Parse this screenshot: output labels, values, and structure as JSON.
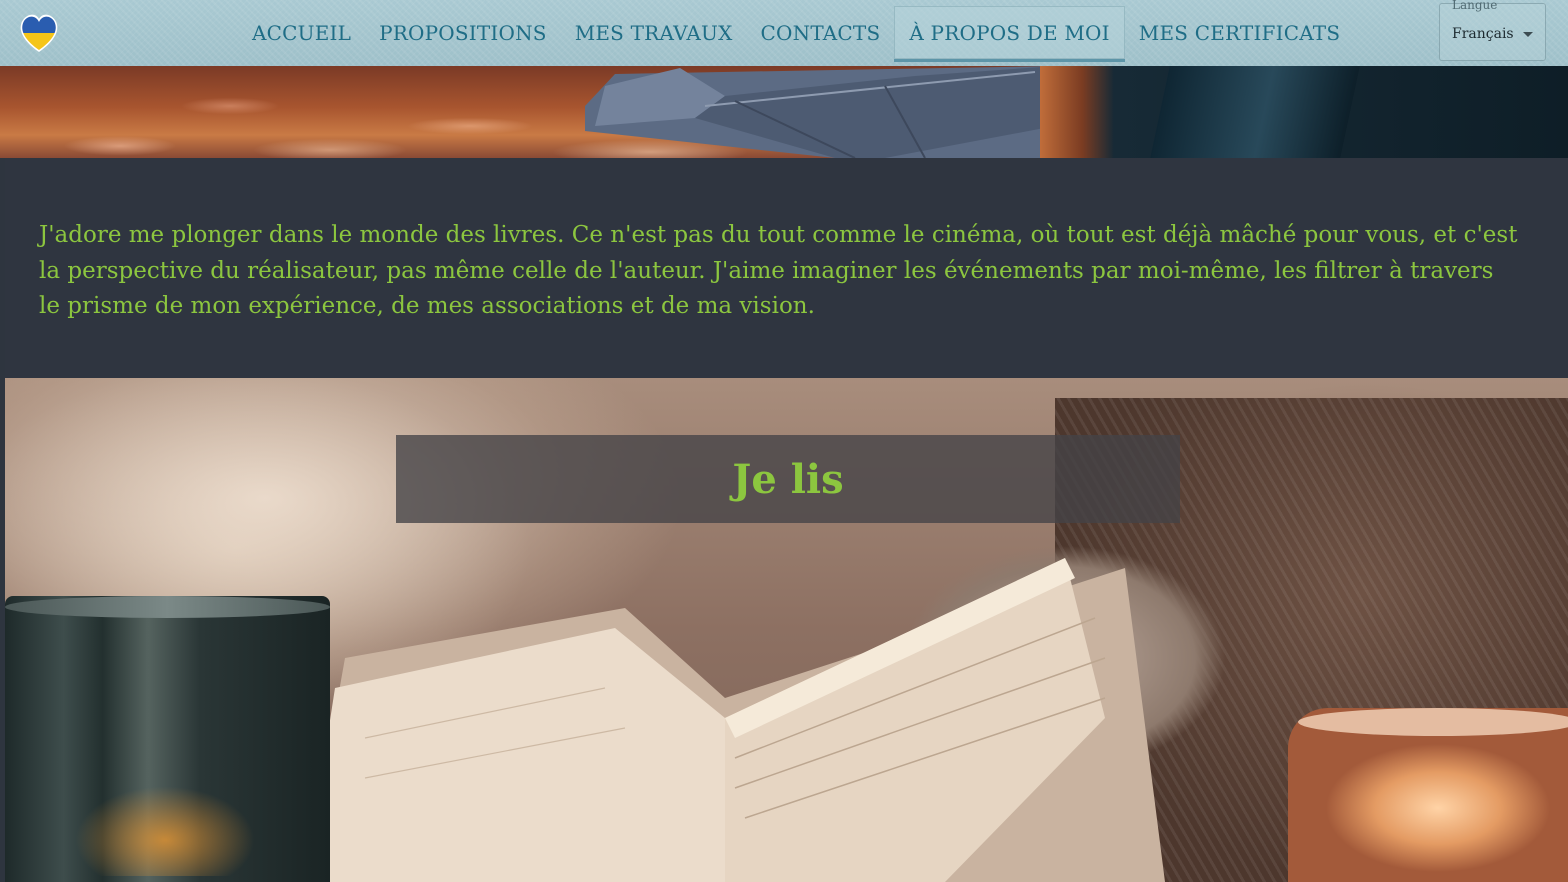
{
  "header": {
    "logo_icon": "heart-flag-icon",
    "nav": [
      {
        "label": "ACCUEIL",
        "active": false
      },
      {
        "label": "PROPOSITIONS",
        "active": false
      },
      {
        "label": "MES TRAVAUX",
        "active": false
      },
      {
        "label": "CONTACTS",
        "active": false
      },
      {
        "label": "À PROPOS DE MOI",
        "active": true
      },
      {
        "label": "MES CERTIFICATS",
        "active": false
      }
    ],
    "language": {
      "label": "Langue",
      "value": "Français"
    }
  },
  "section": {
    "intro_text": "J'adore me plonger dans le monde des livres. Ce n'est pas du tout comme le cinéma, où tout est déjà mâché pour vous, et c'est la perspective du réalisateur, pas même celle de l'auteur. J'aime imaginer les événements par moi-même, les filtrer à travers le prisme de mon expérience, de mes associations et de ma vision.",
    "hobby_title": "Je lis"
  },
  "colors": {
    "accent_green": "#8cc63f",
    "nav_text": "#1f6d86",
    "band_bg": "#2f3540"
  }
}
